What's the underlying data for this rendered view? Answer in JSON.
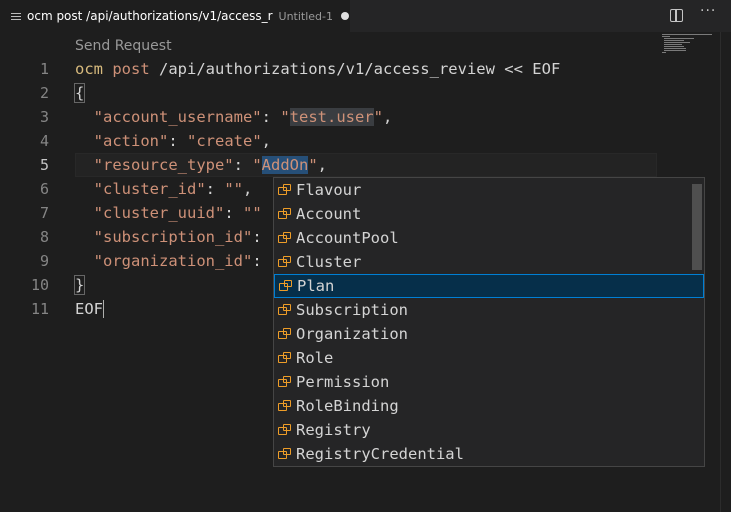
{
  "tab": {
    "title": "ocm post /api/authorizations/v1/access_r",
    "description": "Untitled-1",
    "icon": "file-lines-icon",
    "dirty_indicator": "dot-icon"
  },
  "codelens": "Send Request",
  "editor": {
    "lines": [
      {
        "n": "1"
      },
      {
        "n": "2"
      },
      {
        "n": "3"
      },
      {
        "n": "4"
      },
      {
        "n": "5"
      },
      {
        "n": "6"
      },
      {
        "n": "7"
      },
      {
        "n": "8"
      },
      {
        "n": "9"
      },
      {
        "n": "10"
      },
      {
        "n": "11"
      }
    ],
    "tokens": {
      "l1_a": "ocm",
      "l1_b": "post",
      "l1_c": " /api/authorizations/v1/access_review << EOF",
      "l2": "{",
      "l3_k": "  \"account_username\"",
      "l3_s": ": ",
      "l3_v1": "\"",
      "l3_v2": "test.user",
      "l3_v3": "\"",
      "l3_e": ",",
      "l4_k": "  \"action\"",
      "l4_s": ": ",
      "l4_v": "\"create\"",
      "l4_e": ",",
      "l5_k": "  \"resource_type\"",
      "l5_s": ": ",
      "l5_v1": "\"",
      "l5_v2": "AddOn",
      "l5_v3": "\"",
      "l5_e": ",",
      "l6_k": "  \"cluster_id\"",
      "l6_s": ": ",
      "l6_v": "\"\"",
      "l6_e": ",",
      "l7_k": "  \"cluster_uuid\"",
      "l7_s": ": ",
      "l7_v": "\"\"",
      "l8_k": "  \"subscription_id\"",
      "l8_s": ":",
      "l9_k": "  \"organization_id\"",
      "l9_s": ":",
      "l10": "}",
      "l11": "EOF"
    }
  },
  "suggestions": [
    {
      "label": "Flavour"
    },
    {
      "label": "Account"
    },
    {
      "label": "AccountPool"
    },
    {
      "label": "Cluster"
    },
    {
      "label": "Plan",
      "selected": true
    },
    {
      "label": "Subscription"
    },
    {
      "label": "Organization"
    },
    {
      "label": "Role"
    },
    {
      "label": "Permission"
    },
    {
      "label": "RoleBinding"
    },
    {
      "label": "Registry"
    },
    {
      "label": "RegistryCredential"
    }
  ],
  "toolbar": {
    "split": "split-editor-icon",
    "more": "more-actions-icon"
  },
  "colors": {
    "accent": "#007fd4",
    "selected_bg": "#062f4a",
    "keyword": "#ce9178",
    "string": "#ce9178",
    "suggest_icon": "#ee9d28"
  }
}
